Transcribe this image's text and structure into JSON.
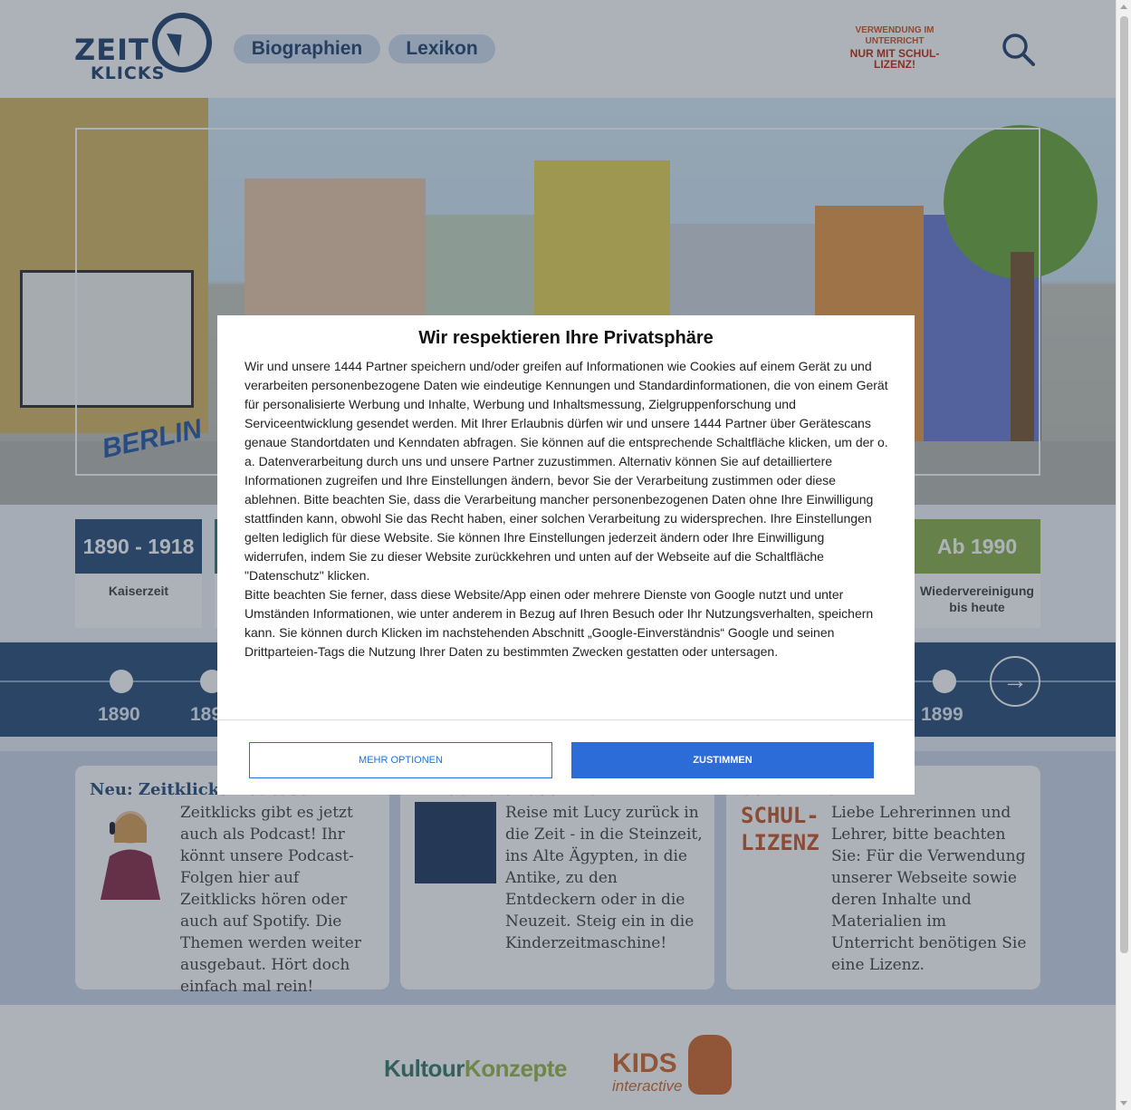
{
  "header": {
    "logo_line1": "ZEIT",
    "logo_line2": "KLICKS",
    "nav": [
      "Biographien",
      "Lexikon"
    ],
    "license_line1": "VERWENDUNG IM UNTERRICHT",
    "license_line2": "NUR MIT SCHUL-LIZENZ!",
    "search_icon": "search-icon"
  },
  "hero": {
    "graffiti": "BERLIN"
  },
  "eras": [
    {
      "years": "1890 - 1918",
      "name": "Kaiserzeit",
      "color": "#2c4f7a"
    },
    {
      "years": "Ab 1990",
      "name": "Wiedervereinigung bis heute",
      "color": "#8fb14d"
    }
  ],
  "timeline": {
    "years_visible": [
      "1890",
      "189",
      "1899"
    ],
    "next_icon": "arrow-right-icon"
  },
  "teasers": [
    {
      "title": "Neu: Zeitklicks-Podcast",
      "text": "Zeitklicks gibt es jetzt auch als Podcast! Ihr könnt unsere Podcast-Folgen hier auf Zeitklicks hören oder auch auf Spotify. Die Themen werden weiter ausgebaut. Hört doch einfach mal rein!"
    },
    {
      "title": "Kinderzeitmaschine",
      "text": "Reise mit Lucy zurück in die Zeit - in die Steinzeit, ins Alte Ägypten, in die Antike, zu den Entdeckern oder in die Neuzeit. Steig ein in die Kinderzeitmaschine!"
    },
    {
      "title": "Schul-Lizenz",
      "text": "Liebe Lehrerinnen und Lehrer, bitte beachten Sie: Für die Verwendung unserer Webseite sowie deren Inhalte und Materialien im Unterricht benötigen Sie eine Lizenz.",
      "badge": "SCHUL- LIZENZ"
    }
  ],
  "footer": {
    "partner1_a": "Kultour",
    "partner1_b": "Konzepte",
    "partner2_a": "KIDS",
    "partner2_b": "interactive"
  },
  "consent": {
    "title": "Wir respektieren Ihre Privatsphäre",
    "body1": "Wir und unsere 1444 Partner speichern und/oder greifen auf Informationen wie Cookies auf einem Gerät zu und verarbeiten personenbezogene Daten wie eindeutige Kennungen und Standardinformationen, die von einem Gerät für personalisierte Werbung und Inhalte, Werbung und Inhaltsmessung, Zielgruppenforschung und Serviceentwicklung gesendet werden. Mit Ihrer Erlaubnis dürfen wir und unsere 1444 Partner über Gerätescans genaue Standortdaten und Kenndaten abfragen. Sie können auf die entsprechende Schaltfläche klicken, um der o. a. Datenverarbeitung durch uns und unsere Partner zuzustimmen. Alternativ können Sie auf detailliertere Informationen zugreifen und Ihre Einstellungen ändern, bevor Sie der Verarbeitung zustimmen oder diese ablehnen. Bitte beachten Sie, dass die Verarbeitung mancher personenbezogenen Daten ohne Ihre Einwilligung stattfinden kann, obwohl Sie das Recht haben, einer solchen Verarbeitung zu widersprechen. Ihre Einstellungen gelten lediglich für diese Website. Sie können Ihre Einstellungen jederzeit ändern oder Ihre Einwilligung widerrufen, indem Sie zu dieser Website zurückkehren und unten auf der Webseite auf die Schaltfläche \"Datenschutz\" klicken.",
    "body2": "Bitte beachten Sie ferner, dass diese Website/App einen oder mehrere Dienste von Google nutzt und unter Umständen Informationen, wie unter anderem in Bezug auf Ihren Besuch oder Ihr Nutzungsverhalten, speichern kann. Sie können durch Klicken im nachstehenden Abschnitt „Google-Einverständnis“ Google und seinen Drittparteien-Tags die Nutzung Ihrer Daten zu bestimmten Zwecken gestatten oder untersagen.",
    "more_label": "MEHR OPTIONEN",
    "agree_label": "ZUSTIMMEN"
  }
}
